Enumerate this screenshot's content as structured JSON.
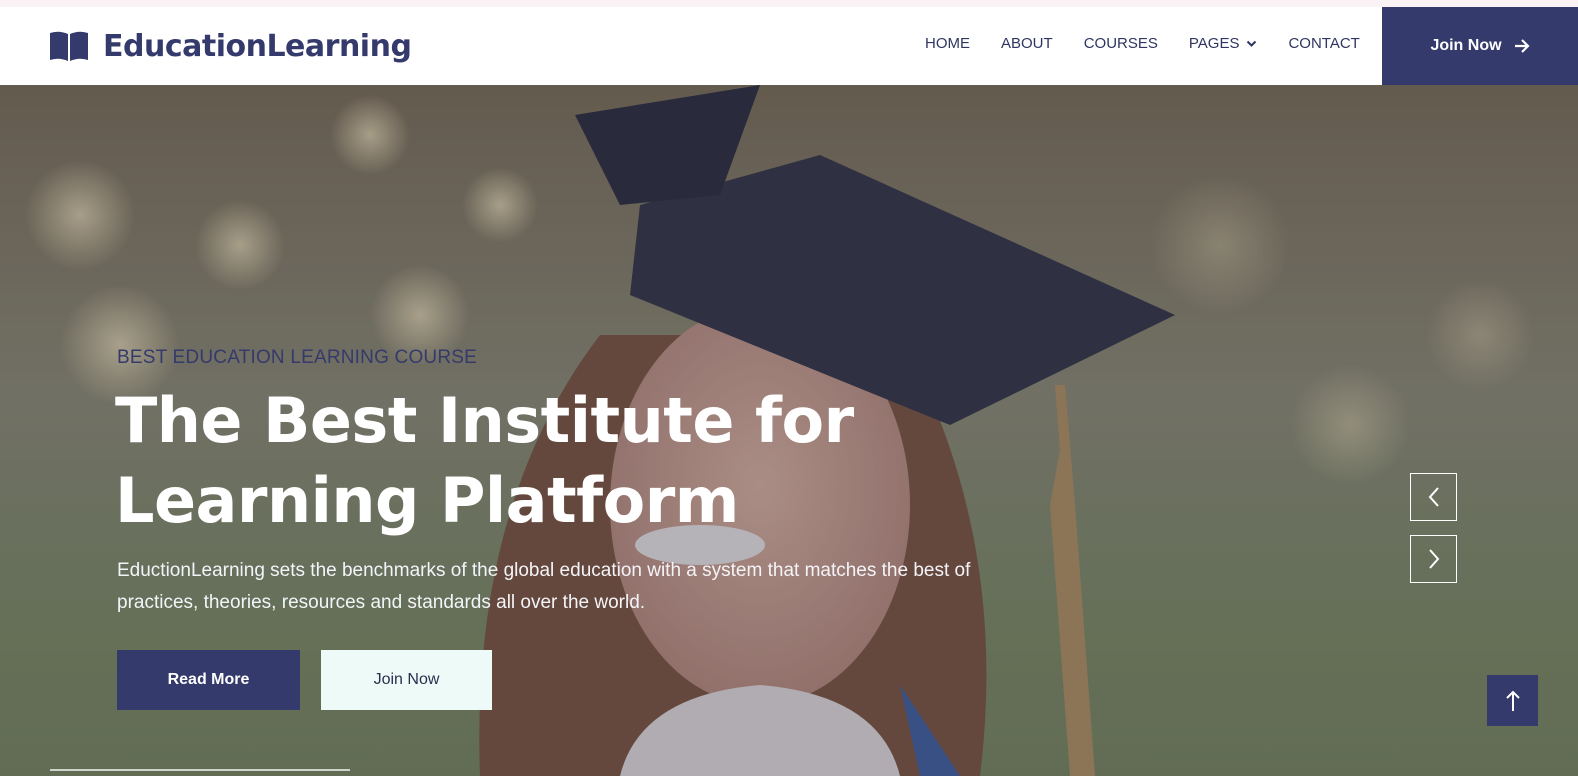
{
  "brand": {
    "name": "EducationLearning",
    "icon": "open-book-icon"
  },
  "nav": {
    "items": [
      {
        "label": "HOME"
      },
      {
        "label": "ABOUT"
      },
      {
        "label": "COURSES"
      },
      {
        "label": "PAGES",
        "icon": "chevron-down-icon"
      },
      {
        "label": "CONTACT"
      }
    ],
    "cta": {
      "label": "Join Now",
      "icon": "arrow-right-icon"
    }
  },
  "hero": {
    "eyebrow": "BEST EDUCATION LEARNING COURSE",
    "headline_line1": "The Best Institute for",
    "headline_line2": "Learning Platform",
    "description": "EductionLearning sets the benchmarks of the global education with a system that matches the best of practices, theories, resources and standards all over the world.",
    "primary_button": "Read More",
    "secondary_button": "Join Now",
    "carousel": {
      "prev_icon": "chevron-left-icon",
      "next_icon": "chevron-right-icon"
    }
  },
  "back_to_top": {
    "icon": "arrow-up-icon"
  },
  "colors": {
    "brand": "#343a6b",
    "light_button": "#eefaf8",
    "nav_text": "#2f3560"
  }
}
